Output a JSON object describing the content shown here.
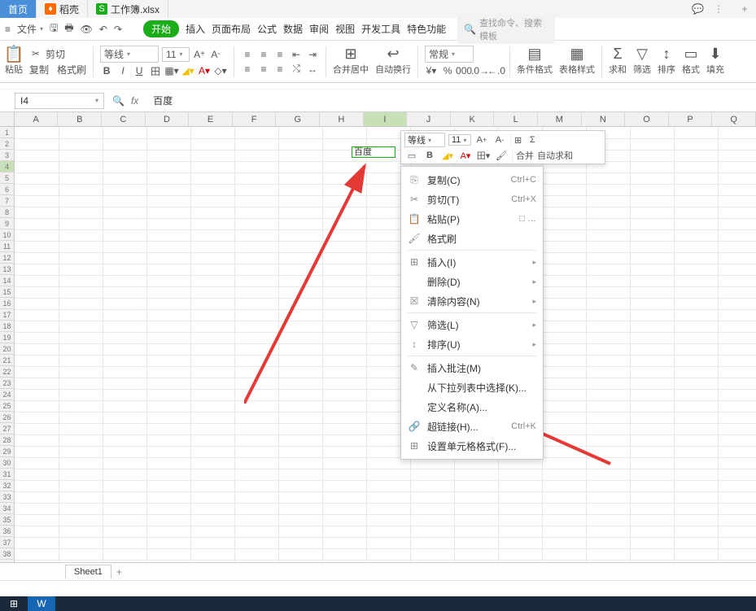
{
  "tabs": {
    "home": "首页",
    "doc1_icon_color": "#ff6a00",
    "doc1": "稻壳",
    "doc2_icon": "S",
    "doc2": "工作簿.xlsx"
  },
  "quickbar": {
    "file_menu": "文件"
  },
  "ribbon_tabs": {
    "start": "开始",
    "insert": "插入",
    "layout": "页面布局",
    "formula": "公式",
    "data": "数据",
    "review": "审阅",
    "view": "视图",
    "dev": "开发工具",
    "special": "特色功能"
  },
  "search": {
    "placeholder": "查找命令、搜索模板"
  },
  "ribbon": {
    "paste": "粘贴",
    "cut": "剪切",
    "copy": "复制",
    "format_painter": "格式刷",
    "font_name": "等线",
    "font_size": "11",
    "merge_center": "合并居中",
    "wrap": "自动换行",
    "number_fmt": "常规",
    "cond_fmt": "条件格式",
    "cell_style": "表格样式",
    "sum": "求和",
    "filter": "筛选",
    "sort": "排序",
    "format": "格式",
    "fill": "填充"
  },
  "formula_bar": {
    "name_box": "I4",
    "fx": "fx",
    "value": "百度"
  },
  "columns": [
    "A",
    "B",
    "C",
    "D",
    "E",
    "F",
    "G",
    "H",
    "I",
    "J",
    "K",
    "L",
    "M",
    "N",
    "O",
    "P",
    "Q"
  ],
  "active_col": "I",
  "active_row": 4,
  "row_count": 39,
  "cell_value": "百度",
  "mini_toolbar": {
    "font_name": "等线",
    "font_size": "11",
    "merge": "合并",
    "autosum": "自动求和"
  },
  "context_menu": [
    {
      "icon": "⎘",
      "label": "复制(C)",
      "shortcut": "Ctrl+C"
    },
    {
      "icon": "✂",
      "label": "剪切(T)",
      "shortcut": "Ctrl+X"
    },
    {
      "icon": "📋",
      "label": "粘贴(P)",
      "extra": "□ …"
    },
    {
      "icon": "🖌",
      "label": "格式刷"
    },
    {
      "sep": true
    },
    {
      "icon": "⊞",
      "label": "插入(I)",
      "caret": true
    },
    {
      "icon": "",
      "label": "删除(D)",
      "caret": true
    },
    {
      "icon": "☒",
      "label": "清除内容(N)",
      "caret": true
    },
    {
      "sep": true
    },
    {
      "icon": "▽",
      "label": "筛选(L)",
      "caret": true
    },
    {
      "icon": "↕",
      "label": "排序(U)",
      "caret": true
    },
    {
      "sep": true
    },
    {
      "icon": "✎",
      "label": "插入批注(M)"
    },
    {
      "icon": "",
      "label": "从下拉列表中选择(K)..."
    },
    {
      "icon": "",
      "label": "定义名称(A)..."
    },
    {
      "icon": "🔗",
      "label": "超链接(H)...",
      "shortcut": "Ctrl+K"
    },
    {
      "icon": "⊞",
      "label": "设置单元格格式(F)..."
    }
  ],
  "sheet": {
    "name": "Sheet1"
  }
}
